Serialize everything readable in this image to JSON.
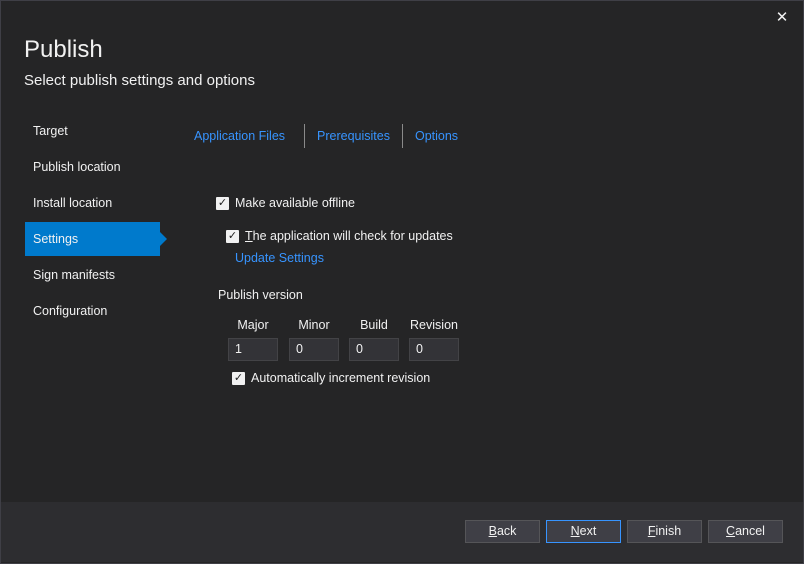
{
  "window": {
    "title": "Publish",
    "subtitle": "Select publish settings and options",
    "close_glyph": "✕"
  },
  "nav": [
    {
      "label": "Target"
    },
    {
      "label": "Publish location"
    },
    {
      "label": "Install location"
    },
    {
      "label": "Settings",
      "active": true
    },
    {
      "label": "Sign manifests"
    },
    {
      "label": "Configuration"
    }
  ],
  "tabs": [
    "Application Files",
    "Prerequisites",
    "Options"
  ],
  "settings": {
    "offline_label": "Make available offline",
    "offline_checked": true,
    "updates_label_first": "T",
    "updates_label_rest": "he application will check for updates",
    "updates_checked": true,
    "update_settings_link": "Update Settings",
    "publish_version_label": "Publish version",
    "version": {
      "major_label": "Major",
      "major": "1",
      "minor_label": "Minor",
      "minor": "0",
      "build_label": "Build",
      "build": "0",
      "revision_label": "Revision",
      "revision": "0"
    },
    "auto_increment_label": "Automatically increment revision",
    "auto_increment_checked": true
  },
  "buttons": {
    "back_first": "B",
    "back_rest": "ack",
    "next_first": "N",
    "next_rest": "ext",
    "finish_first": "F",
    "finish_rest": "inish",
    "cancel_first": "C",
    "cancel_rest": "ancel"
  },
  "colors": {
    "accent": "#007acc",
    "link": "#3794ff",
    "background": "#252526"
  },
  "icons": {
    "close": "close-icon",
    "check": "checkmark-icon"
  }
}
